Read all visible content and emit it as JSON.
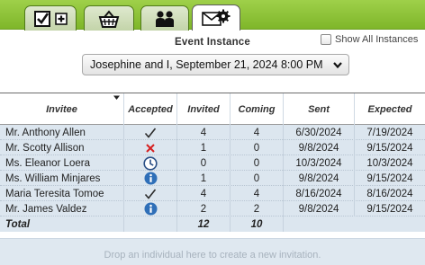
{
  "tabs": [
    {
      "icon": "checklist-plus-icon",
      "active": false
    },
    {
      "icon": "basket-icon",
      "active": false
    },
    {
      "icon": "people-icon",
      "active": false
    },
    {
      "icon": "envelope-gear-icon",
      "active": true
    }
  ],
  "header": {
    "title": "Event Instance",
    "show_all_label": "Show All Instances",
    "show_all_checked": false,
    "instance_value": "Josephine and I, September 21, 2024 8:00 PM"
  },
  "table": {
    "columns": [
      "Invitee",
      "Accepted",
      "Invited",
      "Coming",
      "Sent",
      "Expected"
    ],
    "rows": [
      {
        "name": "Mr. Anthony Allen",
        "accepted": "check-icon",
        "invited": "4",
        "coming": "4",
        "sent": "6/30/2024",
        "expected": "7/19/2024"
      },
      {
        "name": "Mr. Scotty Allison",
        "accepted": "x-icon",
        "invited": "1",
        "coming": "0",
        "sent": "9/8/2024",
        "expected": "9/15/2024"
      },
      {
        "name": "Ms. Eleanor Loera",
        "accepted": "clock-icon",
        "invited": "0",
        "coming": "0",
        "sent": "10/3/2024",
        "expected": "10/3/2024"
      },
      {
        "name": "Ms. William Minjares",
        "accepted": "info-icon",
        "invited": "1",
        "coming": "0",
        "sent": "9/8/2024",
        "expected": "9/15/2024"
      },
      {
        "name": "Maria Teresita Tomoe",
        "accepted": "check-icon",
        "invited": "4",
        "coming": "4",
        "sent": "8/16/2024",
        "expected": "8/16/2024"
      },
      {
        "name": "Mr. James Valdez",
        "accepted": "info-icon",
        "invited": "2",
        "coming": "2",
        "sent": "9/8/2024",
        "expected": "9/15/2024"
      }
    ],
    "total": {
      "label": "Total",
      "invited": "12",
      "coming": "10"
    }
  },
  "drop_hint": "Drop an individual here to create a new invitation.",
  "colors": {
    "tabbar": "#8cc33a",
    "table_bg": "#dce6ef",
    "accent_blue": "#2f6fb8",
    "reject_red": "#d62020"
  }
}
